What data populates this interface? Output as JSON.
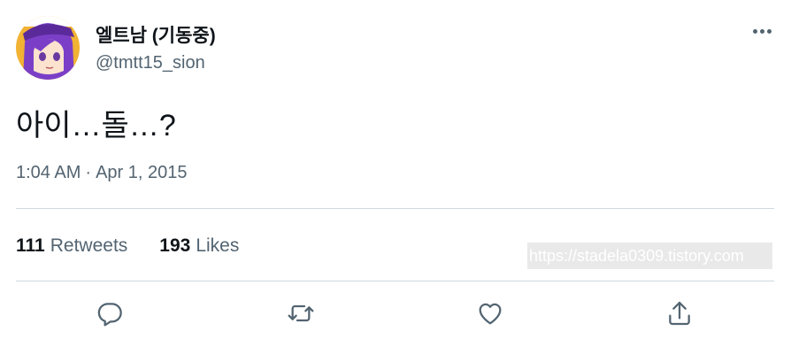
{
  "tweet": {
    "author": {
      "display_name": "엘트남 (기동중)",
      "handle": "@tmtt15_sion"
    },
    "text": "아이…돌…?",
    "time": "1:04 AM",
    "separator": "·",
    "date": "Apr 1, 2015",
    "stats": {
      "retweets_count": "111",
      "retweets_label": "Retweets",
      "likes_count": "193",
      "likes_label": "Likes"
    }
  },
  "watermark": "https://stadela0309.tistory.com",
  "icons": {
    "more": "more-horizontal-icon",
    "reply": "reply-icon",
    "retweet": "retweet-icon",
    "like": "heart-icon",
    "share": "share-icon"
  },
  "colors": {
    "text_primary": "#0f1419",
    "text_secondary": "#536471",
    "divider": "#cfd9de"
  }
}
